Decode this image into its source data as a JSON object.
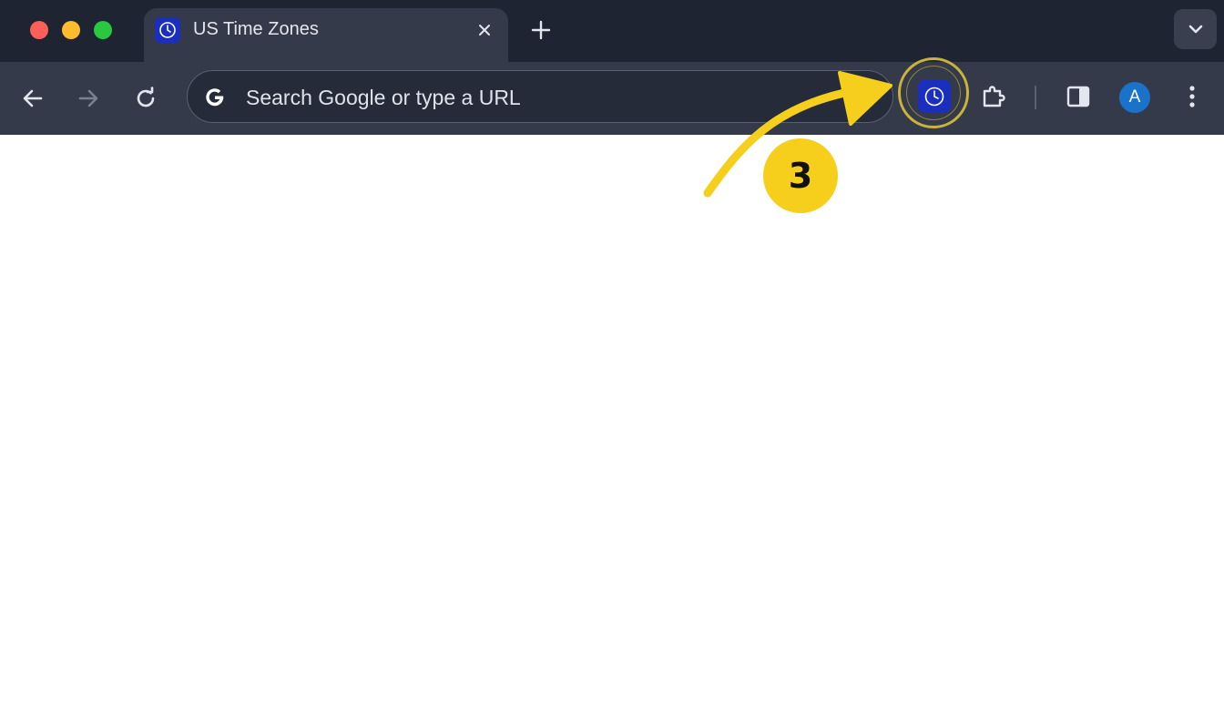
{
  "window": {
    "traffic_lights": {
      "close": "#ff5f57",
      "minimize": "#febc2e",
      "maximize": "#28c840"
    }
  },
  "tabs": [
    {
      "title": "US Time Zones",
      "favicon": "clock-icon",
      "active": true
    }
  ],
  "tabstrip": {
    "new_tab_icon": "plus-icon",
    "tab_search_icon": "chevron-down-icon"
  },
  "toolbar": {
    "back_icon": "arrow-left-icon",
    "forward_icon": "arrow-right-icon",
    "reload_icon": "reload-icon",
    "omnibox": {
      "placeholder": "Search Google or type a URL",
      "value": "",
      "logo": "google-g-icon"
    },
    "extension": {
      "name": "US Time Zones",
      "icon": "clock-icon",
      "highlighted": true
    },
    "extensions_menu_icon": "puzzle-icon",
    "side_panel_icon": "side-panel-icon",
    "profile": {
      "initial": "A",
      "color": "#1a73c9"
    },
    "menu_icon": "kebab-menu-icon"
  },
  "annotation": {
    "step_number": "3",
    "color": "#f6cf1c",
    "target": "extension-button"
  },
  "colors": {
    "tabstrip_bg": "#1f2433",
    "toolbar_bg": "#353a4a",
    "extension_bg": "#1a2fbf",
    "page_bg": "#ffffff"
  }
}
